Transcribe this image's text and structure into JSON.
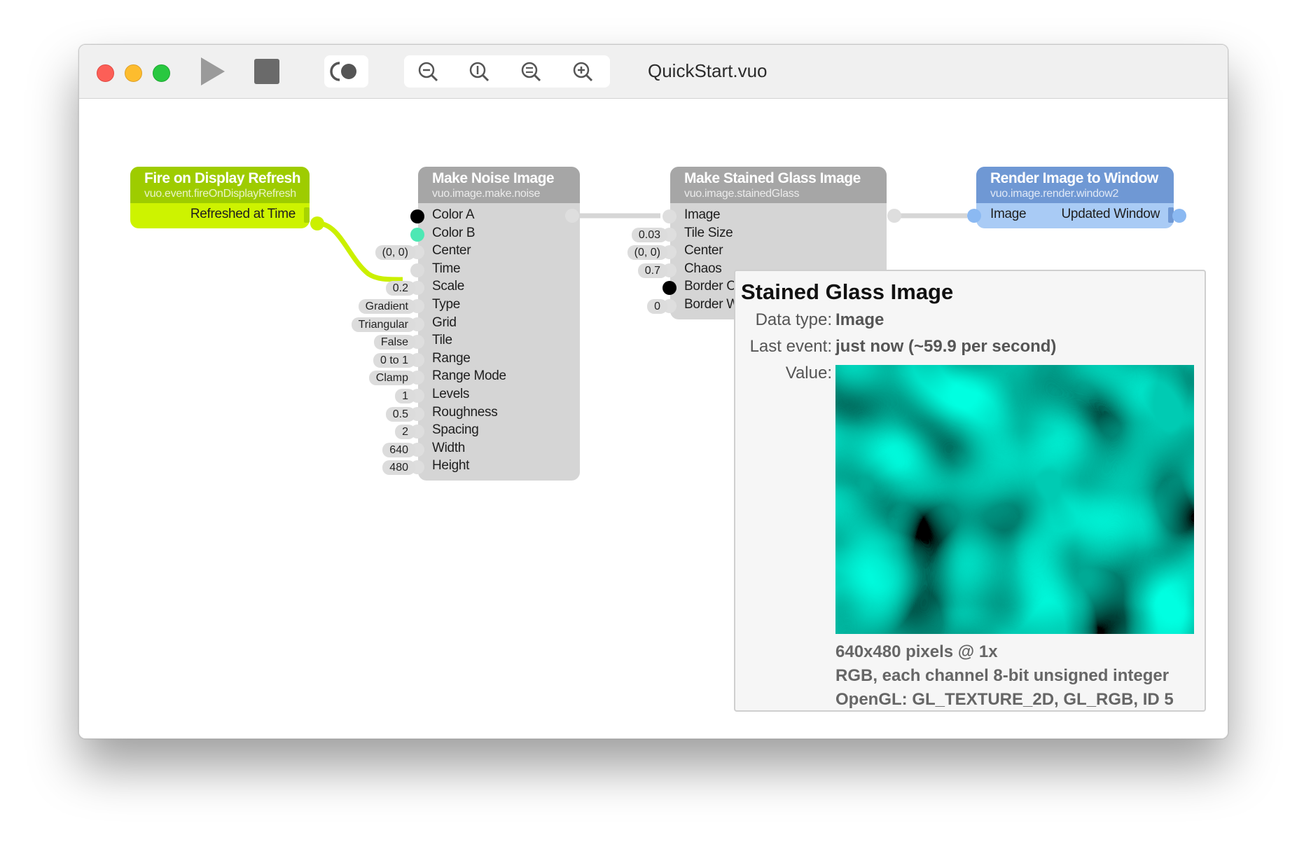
{
  "window": {
    "title": "QuickStart.vuo",
    "toolbar": {
      "run_icon": "play-icon",
      "stop_icon": "stop-icon",
      "show_events_icon": "show-events-icon",
      "zoom_out_icon": "zoom-out-icon",
      "actual_size_icon": "zoom-actual-size-icon",
      "zoom_to_fit_icon": "zoom-to-fit-icon",
      "zoom_in_icon": "zoom-in-icon"
    }
  },
  "nodes": {
    "fire": {
      "title": "Fire on Display Refresh",
      "class_name": "vuo.event.fireOnDisplayRefresh",
      "output": "Refreshed at Time",
      "color": "#9ccc00"
    },
    "noise": {
      "title": "Make Noise Image",
      "class_name": "vuo.image.make.noise",
      "ports": [
        {
          "label": "Color A",
          "value": ""
        },
        {
          "label": "Color B",
          "value": ""
        },
        {
          "label": "Center",
          "value": "(0, 0)"
        },
        {
          "label": "Time",
          "value": ""
        },
        {
          "label": "Scale",
          "value": "0.2"
        },
        {
          "label": "Type",
          "value": "Gradient"
        },
        {
          "label": "Grid",
          "value": "Triangular"
        },
        {
          "label": "Tile",
          "value": "False"
        },
        {
          "label": "Range",
          "value": "0 to 1"
        },
        {
          "label": "Range Mode",
          "value": "Clamp"
        },
        {
          "label": "Levels",
          "value": "1"
        },
        {
          "label": "Roughness",
          "value": "0.5"
        },
        {
          "label": "Spacing",
          "value": "2"
        },
        {
          "label": "Width",
          "value": "640"
        },
        {
          "label": "Height",
          "value": "480"
        }
      ]
    },
    "stained": {
      "title": "Make Stained Glass Image",
      "class_name": "vuo.image.stainedGlass",
      "ports": [
        {
          "label": "Image",
          "value": ""
        },
        {
          "label": "Tile Size",
          "value": "0.03"
        },
        {
          "label": "Center",
          "value": "(0, 0)"
        },
        {
          "label": "Chaos",
          "value": "0.7"
        },
        {
          "label": "Border Co",
          "value": ""
        },
        {
          "label": "Border W",
          "value": "0"
        }
      ]
    },
    "render": {
      "title": "Render Image to Window",
      "class_name": "vuo.image.render.window2",
      "input": "Image",
      "output": "Updated Window",
      "color": "#6e97d3"
    }
  },
  "tooltip": {
    "title": "Stained Glass Image",
    "data_type_key": "Data type:",
    "data_type": "Image",
    "last_event_key": "Last event:",
    "last_event": "just now (~59.9 per second)",
    "value_key": "Value:",
    "info": [
      "640x480 pixels @ 1x",
      "RGB, each channel 8-bit unsigned integer",
      "OpenGL: GL_TEXTURE_2D, GL_RGB, ID 5"
    ],
    "noise_color": "#4de8b4"
  }
}
